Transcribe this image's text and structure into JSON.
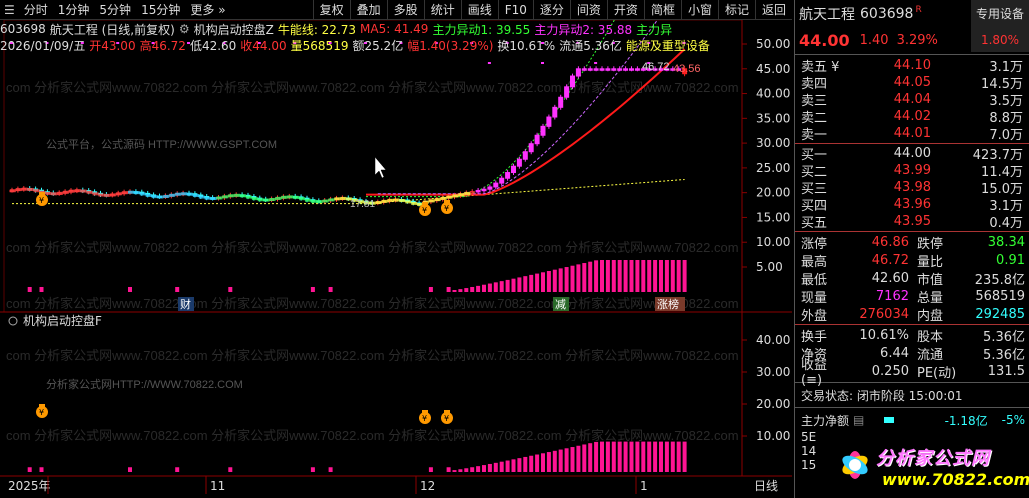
{
  "toolbar": {
    "left_icon": "☰",
    "periods": [
      "分时",
      "1分钟",
      "5分钟",
      "15分钟",
      "更多"
    ],
    "more_arrow": "»",
    "tools": [
      "复权",
      "叠加",
      "多股",
      "统计",
      "画线",
      "F10",
      "逐分",
      "间资",
      "开资",
      "简框",
      "小窗",
      "标记"
    ],
    "return_label": "返回"
  },
  "info_line1": {
    "code": "603698",
    "name_mode": "航天工程 (日线,前复权)",
    "indicator": "机构启动控盘Z",
    "niu": "牛能线: 22.73",
    "ma5": "MA5: 41.49",
    "zl1": "主力异动1: 39.55",
    "zl2": "主力异动2: 35.88",
    "zl3": "主力异"
  },
  "info_line2": {
    "date": "2026/01/09/五",
    "open": "开43.00",
    "high": "高46.72",
    "low": "低42.60",
    "close": "收44.00",
    "vol": "量568519",
    "amount": "额25.2亿",
    "amp": "幅1.40(3.29%)",
    "turnover": "换10.61%",
    "float": "流通5.36亿",
    "sector": "能源及重型设备"
  },
  "chart_labels": {
    "price_axis": [
      "50.00",
      "45.00",
      "40.00",
      "35.00",
      "30.00",
      "25.00",
      "20.00",
      "15.00",
      "10.00",
      "5.00"
    ],
    "sub_axis": [
      "40.00",
      "30.00",
      "20.00",
      "10.00"
    ],
    "dates": [
      "2025年",
      "11",
      "12",
      "1"
    ],
    "day_line": "日线",
    "peak_high": "46.72",
    "peak_last": "43.56",
    "low_label": "17.81",
    "caihao": "财",
    "jian": "减",
    "zhangbang": "涨榜",
    "sub_title": "机构启动控盘F",
    "watermark_gsp": "公式平台，公式源码 HTTP://WWW.GSPT.COM",
    "watermark_url": "分析家公式网HTTP://WWW.70822.COM",
    "watermark_repeat": "com 分析家公式网www.70822.com 分析家公式网www.70822.com 分析家公式网www.70822.com 分析家公式网www.70822.com"
  },
  "panel": {
    "name": "航天工程",
    "code": "603698",
    "tag": "R",
    "sector_btn": "专用设备",
    "price": "44.00",
    "change": "1.40",
    "pct": "3.29%",
    "ratio": "1.80%",
    "asks": [
      {
        "label": "卖五 ¥",
        "price": "44.10",
        "vol": "3.1万"
      },
      {
        "label": "卖四",
        "price": "44.05",
        "vol": "14.5万"
      },
      {
        "label": "卖三",
        "price": "44.04",
        "vol": "3.5万"
      },
      {
        "label": "卖二",
        "price": "44.02",
        "vol": "8.8万"
      },
      {
        "label": "卖一",
        "price": "44.01",
        "vol": "7.0万"
      }
    ],
    "bids": [
      {
        "label": "买一",
        "price": "44.00",
        "vol": "423.7万"
      },
      {
        "label": "买二",
        "price": "43.99",
        "vol": "11.4万"
      },
      {
        "label": "买三",
        "price": "43.98",
        "vol": "15.0万"
      },
      {
        "label": "买四",
        "price": "43.96",
        "vol": "3.1万"
      },
      {
        "label": "买五",
        "price": "43.95",
        "vol": "0.4万"
      }
    ],
    "stats1": [
      {
        "a": "涨停",
        "b": "46.86",
        "bc": "red",
        "c": "跌停",
        "d": "38.34",
        "dc": "green"
      },
      {
        "a": "最高",
        "b": "46.72",
        "bc": "red",
        "c": "量比",
        "d": "0.91",
        "dc": "green"
      },
      {
        "a": "最低",
        "b": "42.60",
        "bc": "white",
        "c": "市值",
        "d": "235.8亿",
        "dc": "white"
      },
      {
        "a": "现量",
        "b": "7162",
        "bc": "magenta",
        "c": "总量",
        "d": "568519",
        "dc": "white"
      },
      {
        "a": "外盘",
        "b": "276034",
        "bc": "red",
        "c": "内盘",
        "d": "292485",
        "dc": "cyan"
      }
    ],
    "stats2": [
      {
        "a": "换手",
        "b": "10.61%",
        "bc": "white",
        "c": "股本",
        "d": "5.36亿",
        "dc": "white"
      },
      {
        "a": "净资",
        "b": "6.44",
        "bc": "white",
        "c": "流通",
        "d": "5.36亿",
        "dc": "white"
      },
      {
        "a": "收益(≡)",
        "b": "0.250",
        "bc": "white",
        "c": "PE(动)",
        "d": "131.5",
        "dc": "white"
      }
    ],
    "trade_state": "交易状态: 闭市阶段 15:00:01",
    "main_flow_label": "主力净额",
    "main_flow_value": "-1.18亿",
    "main_flow_pct": "-5%",
    "cut_rows": [
      "5E",
      "14",
      "15"
    ]
  },
  "logo": {
    "text1": "分析家公式网",
    "text2": "www.70822.com"
  },
  "colors": {
    "up": "#ff3333",
    "down": "#33ff33",
    "candle_up": "#ff33ff",
    "volume": "#ff1493",
    "ma_red": "#ff2020",
    "ma_yellow": "#ffff44",
    "ma_purple": "#cc66ff"
  },
  "chart_data": {
    "type": "candlestick",
    "price_ylim": [
      0,
      52
    ],
    "last_close": 44.0,
    "high": 46.72,
    "low_marker": 17.81,
    "lines": [
      "牛能线",
      "MA5",
      "主力异动1",
      "主力异动2"
    ],
    "sub_ylim": [
      0,
      45
    ]
  }
}
